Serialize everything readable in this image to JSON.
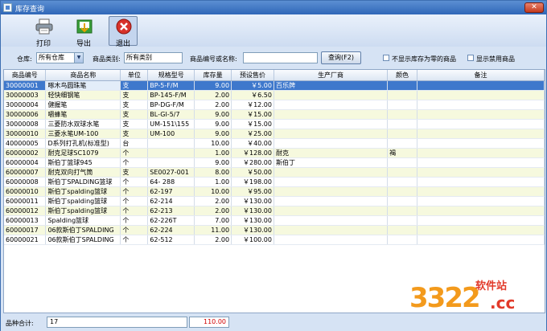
{
  "window": {
    "title": "库存查询",
    "close_glyph": "✕"
  },
  "toolbar": {
    "print_label": "打印",
    "export_label": "导出",
    "exit_label": "退出"
  },
  "filters": {
    "warehouse_label": "仓库:",
    "warehouse_value": "所有仓库",
    "category_label": "商品类别:",
    "category_value": "所有类别",
    "code_name_label": "商品编号或名称:",
    "code_name_value": "",
    "query_button": "查询(F2)",
    "hide_zero_label": "不显示库存为零的商品",
    "show_disabled_label": "显示禁用商品"
  },
  "grid": {
    "columns": [
      "商品编号",
      "商品名称",
      "单位",
      "规格型号",
      "库存量",
      "预设售价",
      "生产厂商",
      "颜色",
      "备注"
    ],
    "rows": [
      {
        "code": "30000001",
        "name": "啄木鸟圆珠笔",
        "unit": "支",
        "spec": "BP-5-F/M",
        "qty": "9.00",
        "price": "￥5.00",
        "maker": "百乐牌",
        "color": "",
        "note": ""
      },
      {
        "code": "30000003",
        "name": "轻快细钢笔",
        "unit": "支",
        "spec": "BP-145-F/M",
        "qty": "2.00",
        "price": "￥6.50",
        "maker": "",
        "color": "",
        "note": ""
      },
      {
        "code": "30000004",
        "name": "健握笔",
        "unit": "支",
        "spec": "BP-DG-F/M",
        "qty": "2.00",
        "price": "￥12.00",
        "maker": "",
        "color": "",
        "note": ""
      },
      {
        "code": "30000006",
        "name": "嚼蜂笔",
        "unit": "支",
        "spec": "BL-GI-5/7",
        "qty": "9.00",
        "price": "￥15.00",
        "maker": "",
        "color": "",
        "note": ""
      },
      {
        "code": "30000008",
        "name": "三菱防水双球水笔",
        "unit": "支",
        "spec": "UM-151\\155",
        "qty": "9.00",
        "price": "￥15.00",
        "maker": "",
        "color": "",
        "note": ""
      },
      {
        "code": "30000010",
        "name": "三菱水笔UM-100",
        "unit": "支",
        "spec": "UM-100",
        "qty": "9.00",
        "price": "￥25.00",
        "maker": "",
        "color": "",
        "note": ""
      },
      {
        "code": "40000005",
        "name": "D系列打孔机(标准型)",
        "unit": "台",
        "spec": "",
        "qty": "10.00",
        "price": "￥40.00",
        "maker": "",
        "color": "",
        "note": ""
      },
      {
        "code": "60000002",
        "name": "耐克足球SC1079",
        "unit": "个",
        "spec": "",
        "qty": "1.00",
        "price": "￥128.00",
        "maker": "耐克",
        "color": "褐",
        "note": ""
      },
      {
        "code": "60000004",
        "name": "斯伯丁篮球945",
        "unit": "个",
        "spec": "",
        "qty": "9.00",
        "price": "￥280.00",
        "maker": "斯伯丁",
        "color": "",
        "note": ""
      },
      {
        "code": "60000007",
        "name": "耐克双向打气筒",
        "unit": "支",
        "spec": "SE0027-001",
        "qty": "8.00",
        "price": "￥50.00",
        "maker": "",
        "color": "",
        "note": ""
      },
      {
        "code": "60000008",
        "name": "斯伯丁SPALDING篮球",
        "unit": "个",
        "spec": "64- 288",
        "qty": "1.00",
        "price": "￥198.00",
        "maker": "",
        "color": "",
        "note": ""
      },
      {
        "code": "60000010",
        "name": "斯伯丁spalding篮球",
        "unit": "个",
        "spec": "62-197",
        "qty": "10.00",
        "price": "￥95.00",
        "maker": "",
        "color": "",
        "note": ""
      },
      {
        "code": "60000011",
        "name": "斯伯丁spalding篮球",
        "unit": "个",
        "spec": "62-214",
        "qty": "2.00",
        "price": "￥130.00",
        "maker": "",
        "color": "",
        "note": ""
      },
      {
        "code": "60000012",
        "name": "斯伯丁spalding篮球",
        "unit": "个",
        "spec": "62-213",
        "qty": "2.00",
        "price": "￥130.00",
        "maker": "",
        "color": "",
        "note": ""
      },
      {
        "code": "60000013",
        "name": "Spalding篮球",
        "unit": "个",
        "spec": "62-226T",
        "qty": "7.00",
        "price": "￥130.00",
        "maker": "",
        "color": "",
        "note": ""
      },
      {
        "code": "60000017",
        "name": "06款斯伯丁SPALDING",
        "unit": "个",
        "spec": "62-224",
        "qty": "11.00",
        "price": "￥130.00",
        "maker": "",
        "color": "",
        "note": ""
      },
      {
        "code": "60000021",
        "name": "06款斯伯丁SPALDING",
        "unit": "个",
        "spec": "62-512",
        "qty": "2.00",
        "price": "￥100.00",
        "maker": "",
        "color": "",
        "note": ""
      }
    ]
  },
  "status": {
    "total_label": "品种合计:",
    "total_count": "17",
    "total_qty": "110.00"
  },
  "watermark": {
    "logo_text": "3322",
    "sub_text": "软件站",
    "tld": ".cc"
  },
  "colors": {
    "selected_row": "#3e78cc",
    "odd_row": "#f6f9de",
    "frame": "#d6e3f4",
    "qty_total": "#d00000"
  }
}
